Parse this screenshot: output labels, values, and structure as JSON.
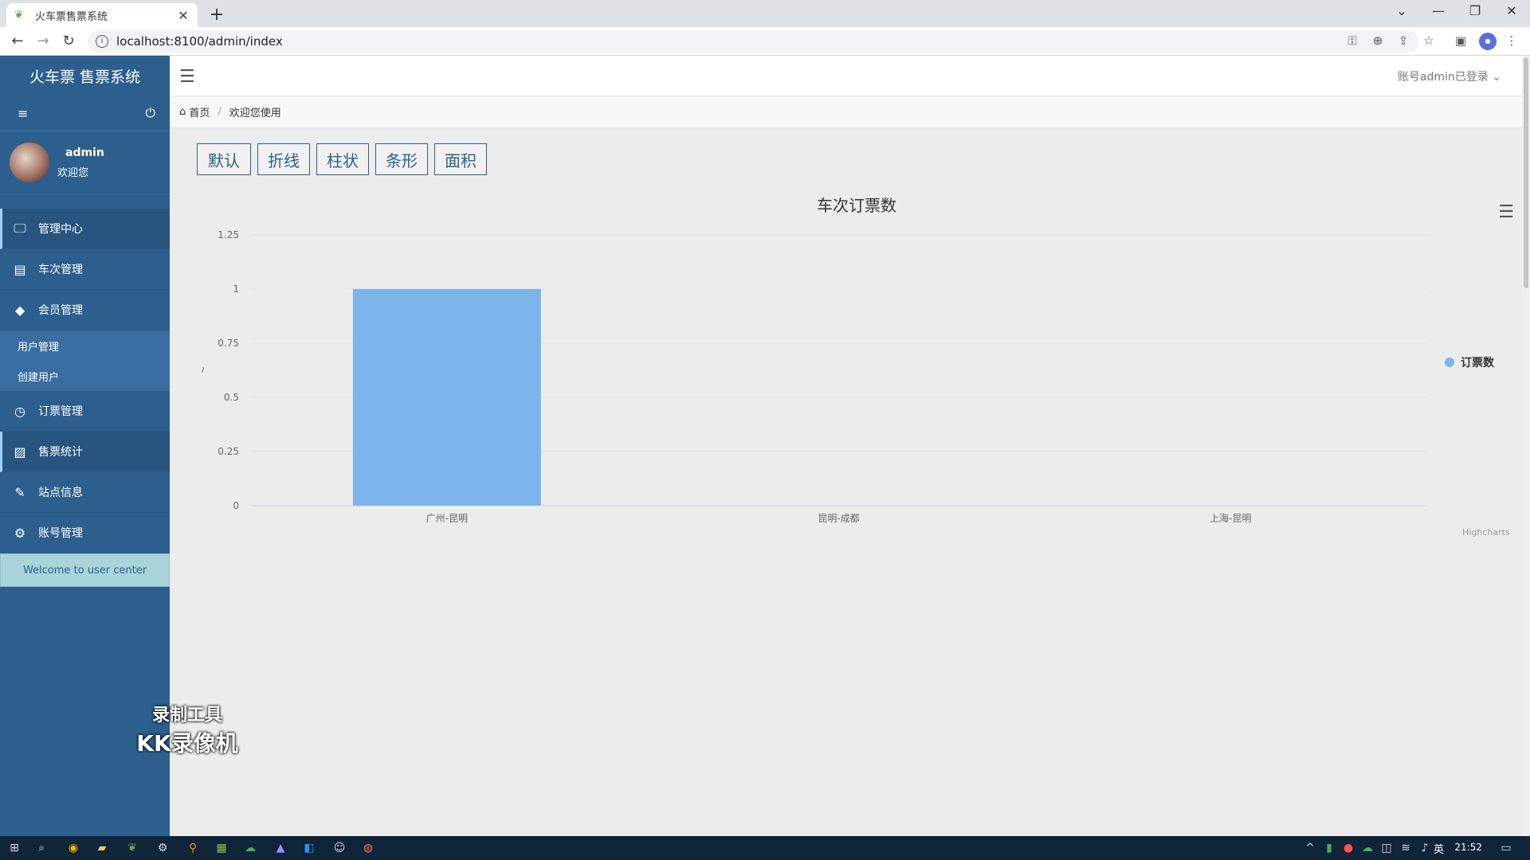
{
  "browser": {
    "tab_title": "火车票售票系统",
    "url": "localhost:8100/admin/index"
  },
  "sidebar": {
    "brand": "火车票 售票系统",
    "user": {
      "name": "admin",
      "greeting": "欢迎您"
    },
    "menu": [
      {
        "label": "管理中心",
        "icon": "monitor-icon"
      },
      {
        "label": "车次管理",
        "icon": "document-icon"
      },
      {
        "label": "会员管理",
        "icon": "tag-icon"
      },
      {
        "label": "订票管理",
        "icon": "clock-icon"
      },
      {
        "label": "售票统计",
        "icon": "image-icon"
      },
      {
        "label": "站点信息",
        "icon": "wand-icon"
      },
      {
        "label": "账号管理",
        "icon": "gears-icon"
      }
    ],
    "submenu": [
      {
        "label": "用户管理"
      },
      {
        "label": "创建用户"
      }
    ],
    "welcome": "Welcome to user center"
  },
  "watermark": {
    "line1": "录制工具",
    "line2": "KK录像机"
  },
  "topnav": {
    "login_status": "账号admin已登录"
  },
  "breadcrumb": {
    "home": "首页",
    "current": "欢迎您使用"
  },
  "chart_buttons": [
    "默认",
    "折线",
    "柱状",
    "条形",
    "面积"
  ],
  "chart_data": {
    "type": "bar",
    "title": "车次订票数",
    "categories": [
      "广州-昆明",
      "昆明-成都",
      "上海-昆明"
    ],
    "series": [
      {
        "name": "订票数",
        "values": [
          1,
          0,
          0
        ],
        "color": "#7cb5ec"
      }
    ],
    "ylim": [
      0,
      1.25
    ],
    "yticks": [
      "0",
      "0.25",
      "0.5",
      "0.75",
      "1",
      "1.25"
    ],
    "ylabel_mark": "~",
    "grid": true,
    "legend": "right",
    "credits": "Highcharts"
  },
  "taskbar": {
    "time": "21:52",
    "lang": "英"
  }
}
